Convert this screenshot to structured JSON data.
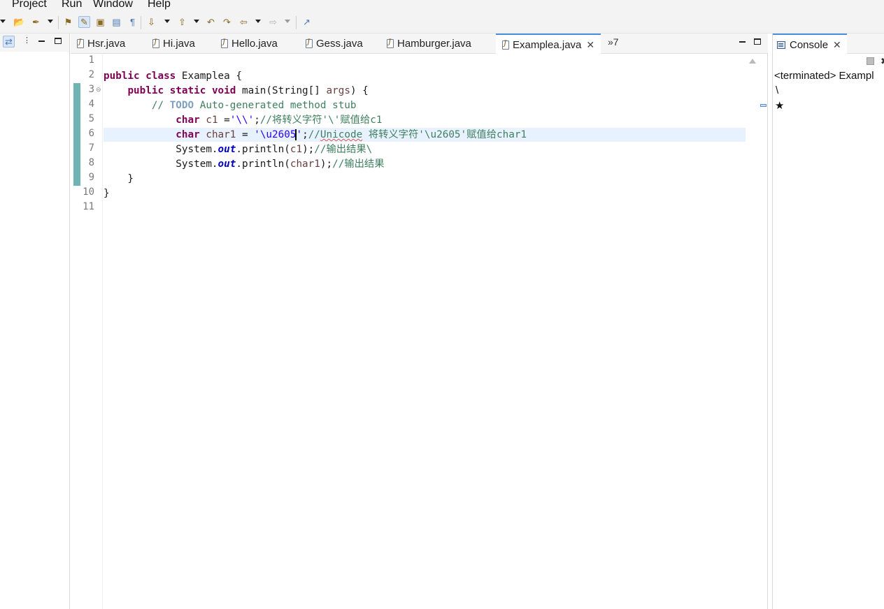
{
  "menu": [
    "Project",
    "Run",
    "Window",
    "Help"
  ],
  "toolbar_icons": [
    "dropdown-arrow",
    "open-folder-icon",
    "build-icon",
    "debug-icon",
    "toggle-mark-occurrences-icon",
    "toggle-block-selection-icon",
    "show-whitespace-icon",
    "pilcrow-icon",
    "next-annotation-icon",
    "previous-annotation-icon",
    "last-edit-icon",
    "forward-edit-icon",
    "back-icon",
    "forward-icon",
    "pin-editor-icon"
  ],
  "editor": {
    "tabs": [
      {
        "label": "Hsr.java",
        "active": false
      },
      {
        "label": "Hi.java",
        "active": false
      },
      {
        "label": "Hello.java",
        "active": false
      },
      {
        "label": "Gess.java",
        "active": false
      },
      {
        "label": "Hamburger.java",
        "active": false
      },
      {
        "label": "Examplea.java",
        "active": true
      }
    ],
    "overflow_label": "»7",
    "line_numbers": [
      "1",
      "2",
      "3",
      "4",
      "5",
      "6",
      "7",
      "8",
      "9",
      "10",
      "11"
    ],
    "current_line": 6,
    "lines": [
      "",
      "public class Examplea {",
      "    public static void main(String[] args) {",
      "        // TODO Auto-generated method stub",
      "            char c1 ='\\\\';//将转义字符'\\'赋值给c1",
      "            char char1 = '\\u2605';//Unicode 将转义字符'\\u2605'赋值给char1",
      "            System.out.println(c1);//输出结果\\",
      "            System.out.println(char1);//输出结果",
      "    }",
      "}",
      ""
    ]
  },
  "console": {
    "tab_label": "Console",
    "header": "<terminated> Exampl",
    "output": [
      "\\",
      "★"
    ]
  },
  "colors": {
    "keyword": "#7f0055",
    "comment": "#3f7f5f",
    "string": "#2a00ff",
    "field": "#0000c0",
    "current_line": "#e8f2fe",
    "active_tab_accent": "#4c8ed9",
    "change_bar": "#6fb3b5"
  }
}
